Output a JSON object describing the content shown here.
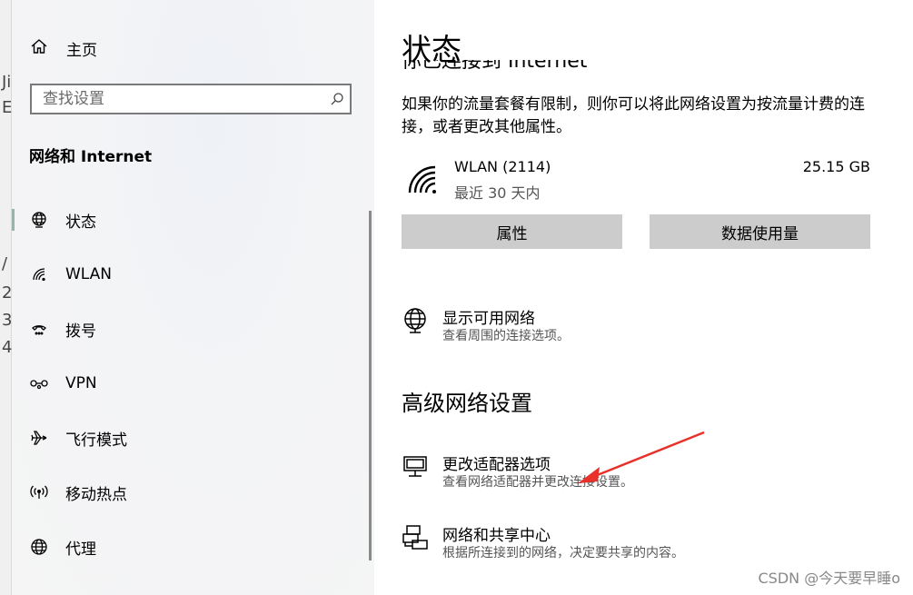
{
  "sidebar": {
    "home_label": "主页",
    "search_placeholder": "查找设置",
    "section_title": "网络和 Internet",
    "items": [
      {
        "label": "状态",
        "icon": "globe-icon"
      },
      {
        "label": "WLAN",
        "icon": "wifi-icon"
      },
      {
        "label": "拨号",
        "icon": "dialup-icon"
      },
      {
        "label": "VPN",
        "icon": "vpn-icon"
      },
      {
        "label": "飞行模式",
        "icon": "airplane-icon"
      },
      {
        "label": "移动热点",
        "icon": "hotspot-icon"
      },
      {
        "label": "代理",
        "icon": "globe-icon"
      }
    ],
    "active_index": 0
  },
  "main": {
    "title": "状态",
    "clipped_heading": "你已连接到 Internet",
    "description": "如果你的流量套餐有限制，则你可以将此网络设置为按流量计费的连接，或者更改其他属性。",
    "connection": {
      "name": "WLAN (2114)",
      "period": "最近 30 天内",
      "usage": "25.15 GB"
    },
    "buttons": {
      "properties": "属性",
      "data_usage": "数据使用量"
    },
    "show_networks": {
      "title": "显示可用网络",
      "subtitle": "查看周围的连接选项。"
    },
    "advanced_heading": "高级网络设置",
    "adapter_options": {
      "title": "更改适配器选项",
      "subtitle": "查看网络适配器并更改连接设置。"
    },
    "sharing_center": {
      "title": "网络和共享中心",
      "subtitle": "根据所连接到的网络，决定要共享的内容。"
    }
  },
  "annotation": {
    "arrow_color": "#e8312a"
  },
  "watermark": "CSDN @今天要早睡o",
  "colors": {
    "button_bg": "#cccccc",
    "sidebar_bg": "#f3f4f6",
    "active_marker": "#8fb8a8"
  }
}
